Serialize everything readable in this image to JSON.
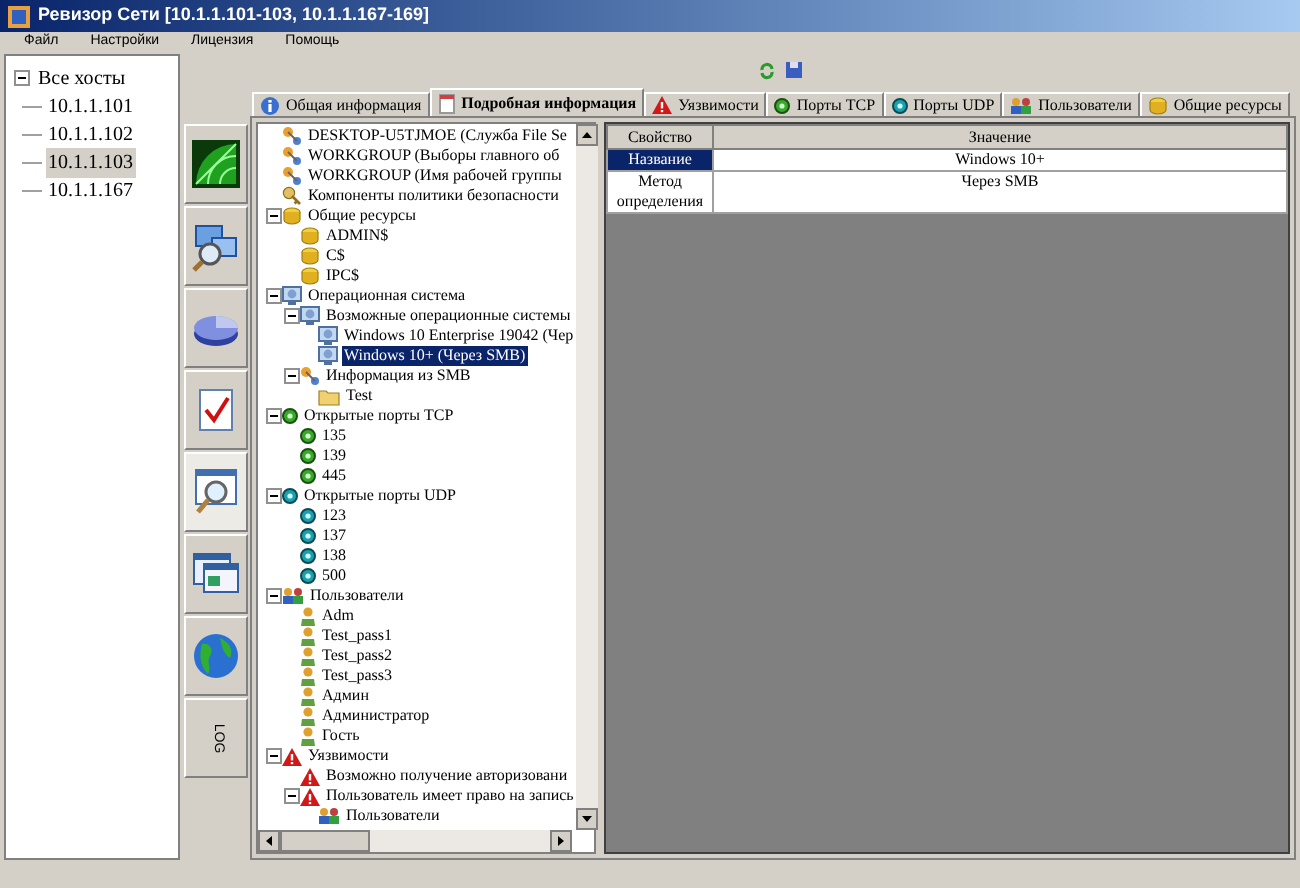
{
  "window": {
    "title": "Ревизор Сети [10.1.1.101-103, 10.1.1.167-169]"
  },
  "menu": [
    "Файл",
    "Настройки",
    "Лицензия",
    "Помощь"
  ],
  "hosts": {
    "label": "Все хосты",
    "expanded": true,
    "children": [
      {
        "label": "10.1.1.101",
        "selected": false
      },
      {
        "label": "10.1.1.102",
        "selected": false
      },
      {
        "label": "10.1.1.103",
        "selected": true
      },
      {
        "label": "10.1.1.167",
        "selected": false
      }
    ]
  },
  "toolbar": [
    {
      "kind": "refresh"
    },
    {
      "kind": "save"
    }
  ],
  "side_buttons": [
    {
      "kind": "radar",
      "selected": false
    },
    {
      "kind": "network",
      "selected": false
    },
    {
      "kind": "pie",
      "selected": false
    },
    {
      "kind": "check",
      "selected": false
    },
    {
      "kind": "magnifier",
      "selected": true
    },
    {
      "kind": "windows",
      "selected": false
    },
    {
      "kind": "globe",
      "selected": false
    },
    {
      "kind": "text",
      "label": "LOG",
      "selected": false
    }
  ],
  "tabs": [
    {
      "label": "Общая информация",
      "kind": "info",
      "selected": false
    },
    {
      "label": "Подробная информация",
      "kind": "doc",
      "selected": true
    },
    {
      "label": "Уязвимости",
      "kind": "warning",
      "selected": false
    },
    {
      "label": "Порты TCP",
      "kind": "tcp",
      "selected": false
    },
    {
      "label": "Порты UDP",
      "kind": "udp",
      "selected": false
    },
    {
      "label": "Пользователи",
      "kind": "users",
      "selected": false
    },
    {
      "label": "Общие ресурсы",
      "kind": "share",
      "selected": false
    }
  ],
  "tree": [
    {
      "label": "DESKTOP-U5TJMOE (Служба File Se",
      "kind": "host",
      "selected": false
    },
    {
      "label": "WORKGROUP (Выборы главного об",
      "kind": "host",
      "selected": false
    },
    {
      "label": "WORKGROUP (Имя рабочей группы",
      "kind": "host",
      "selected": false
    },
    {
      "label": "Компоненты политики безопасности",
      "kind": "policy",
      "selected": false
    },
    {
      "label": "Общие ресурсы",
      "kind": "share",
      "expanded": true,
      "selected": false,
      "children": [
        {
          "label": "ADMIN$",
          "kind": "share",
          "selected": false
        },
        {
          "label": "C$",
          "kind": "share",
          "selected": false
        },
        {
          "label": "IPC$",
          "kind": "share",
          "selected": false
        }
      ]
    },
    {
      "label": "Операционная система",
      "kind": "os",
      "expanded": true,
      "selected": false,
      "children": [
        {
          "label": "Возможные операционные системы",
          "kind": "os",
          "expanded": true,
          "selected": false,
          "children": [
            {
              "label": "Windows 10 Enterprise 19042 (Чер",
              "kind": "os",
              "selected": false
            },
            {
              "label": "Windows 10+ (Через SMB)",
              "kind": "os",
              "selected": true
            }
          ]
        },
        {
          "label": "Информация из SMB",
          "kind": "host",
          "expanded": true,
          "selected": false,
          "children": [
            {
              "label": "Test",
              "kind": "folder",
              "selected": false
            }
          ]
        }
      ]
    },
    {
      "label": "Открытые порты TCP",
      "kind": "tcp",
      "expanded": true,
      "selected": false,
      "children": [
        {
          "label": "135",
          "kind": "tcp",
          "selected": false
        },
        {
          "label": "139",
          "kind": "tcp",
          "selected": false
        },
        {
          "label": "445",
          "kind": "tcp",
          "selected": false
        }
      ]
    },
    {
      "label": "Открытые порты UDP",
      "kind": "udp",
      "expanded": true,
      "selected": false,
      "children": [
        {
          "label": "123",
          "kind": "udp",
          "selected": false
        },
        {
          "label": "137",
          "kind": "udp",
          "selected": false
        },
        {
          "label": "138",
          "kind": "udp",
          "selected": false
        },
        {
          "label": "500",
          "kind": "udp",
          "selected": false
        }
      ]
    },
    {
      "label": "Пользователи",
      "kind": "users",
      "expanded": true,
      "selected": false,
      "children": [
        {
          "label": "Adm",
          "kind": "user",
          "selected": false
        },
        {
          "label": "Test_pass1",
          "kind": "user",
          "selected": false
        },
        {
          "label": "Test_pass2",
          "kind": "user",
          "selected": false
        },
        {
          "label": "Test_pass3",
          "kind": "user",
          "selected": false
        },
        {
          "label": "Админ",
          "kind": "user",
          "selected": false
        },
        {
          "label": "Администратор",
          "kind": "user",
          "selected": false
        },
        {
          "label": "Гость",
          "kind": "user",
          "selected": false
        }
      ]
    },
    {
      "label": "Уязвимости",
      "kind": "warning",
      "expanded": true,
      "selected": false,
      "children": [
        {
          "label": "Возможно получение авторизовани",
          "kind": "warning",
          "selected": false
        },
        {
          "label": "Пользователь имеет право на запись",
          "kind": "warning",
          "expanded": true,
          "selected": false,
          "children": [
            {
              "label": "Пользователи",
              "kind": "users",
              "selected": false
            }
          ]
        }
      ]
    }
  ],
  "grid": {
    "columns": [
      "Свойство",
      "Значение"
    ],
    "rows": [
      {
        "property": "Название",
        "value": "Windows 10+",
        "selected": true
      },
      {
        "property": "Метод определения",
        "value": "Через SMB",
        "selected": false
      }
    ]
  }
}
